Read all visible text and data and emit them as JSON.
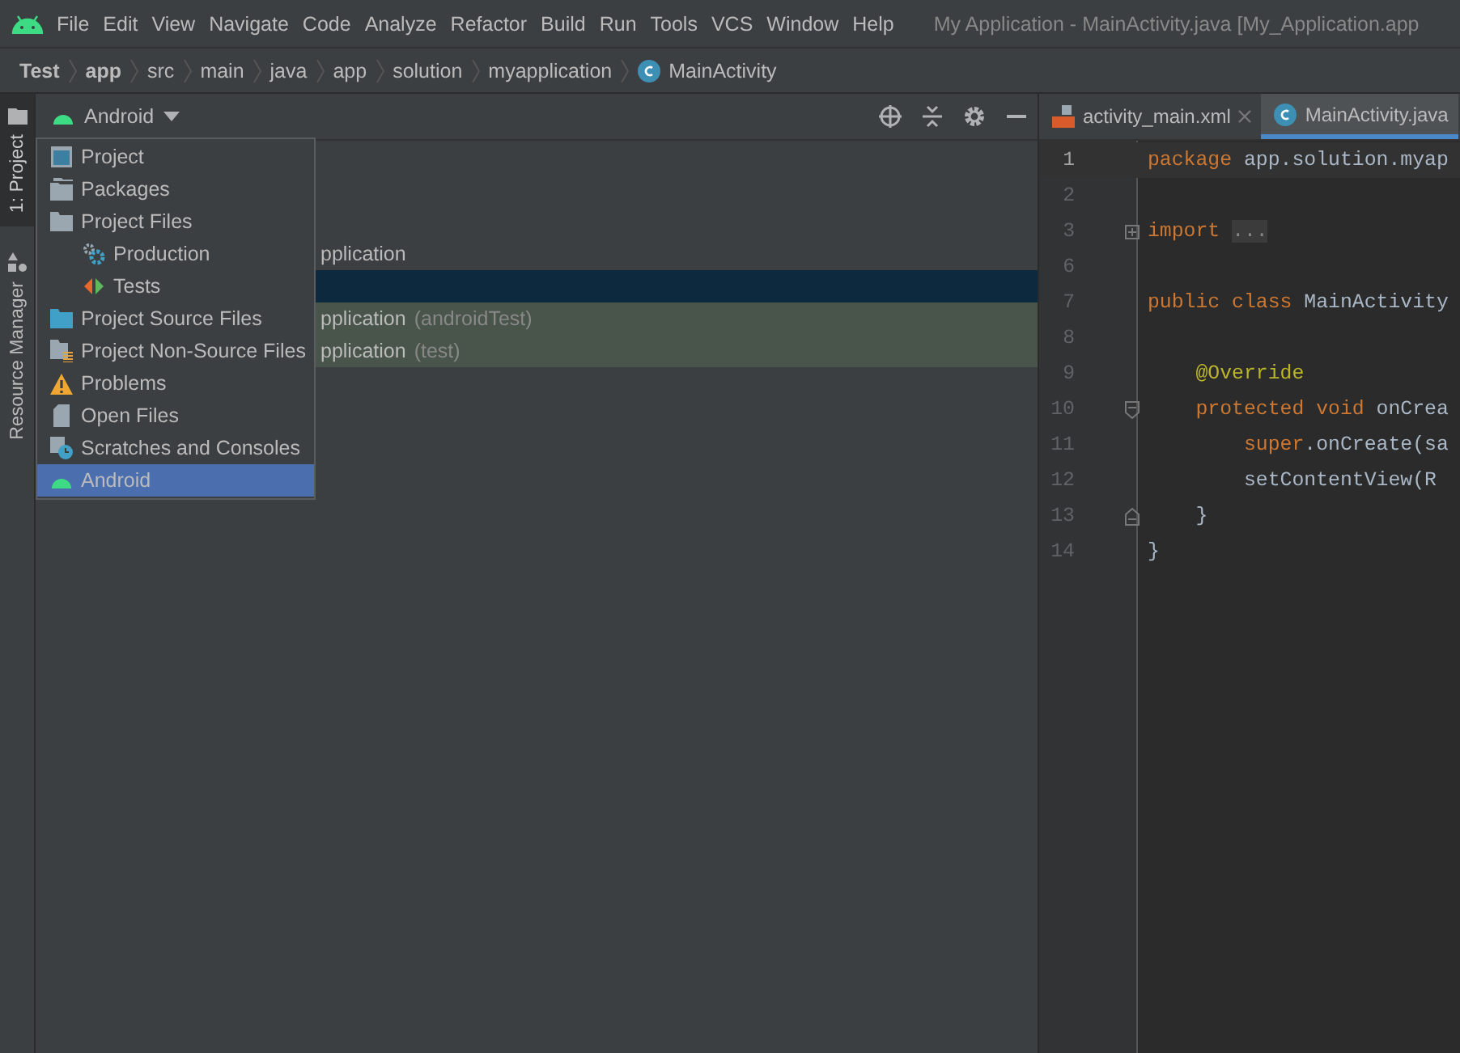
{
  "menu_bar": {
    "items": [
      "File",
      "Edit",
      "View",
      "Navigate",
      "Code",
      "Analyze",
      "Refactor",
      "Build",
      "Run",
      "Tools",
      "VCS",
      "Window",
      "Help"
    ],
    "title": "My Application - MainActivity.java [My_Application.app"
  },
  "breadcrumb": [
    {
      "label": "Test",
      "kind": "module"
    },
    {
      "label": "app",
      "kind": "module"
    },
    {
      "label": "src",
      "kind": "folder"
    },
    {
      "label": "main",
      "kind": "folder"
    },
    {
      "label": "java",
      "kind": "folder"
    },
    {
      "label": "app",
      "kind": "folder"
    },
    {
      "label": "solution",
      "kind": "folder"
    },
    {
      "label": "myapplication",
      "kind": "folder"
    },
    {
      "label": "MainActivity",
      "kind": "class"
    }
  ],
  "side_tabs": [
    {
      "label": "1: Project",
      "selected": true,
      "kind": "project"
    },
    {
      "label": "Resource Manager",
      "selected": false,
      "kind": "resources"
    }
  ],
  "project_panel": {
    "view_selector": "Android",
    "tree_rows": [
      {
        "text": "pplication",
        "selected": false,
        "kind": "plain"
      },
      {
        "selected": true,
        "kind": "plain"
      },
      {
        "text": "pplication",
        "note": "(androidTest)",
        "selected": false,
        "kind": "test"
      },
      {
        "text": "pplication",
        "note": "(test)",
        "selected": false,
        "kind": "test"
      }
    ],
    "view_menu": [
      {
        "label": "Project",
        "kind": "monitor",
        "selected": false
      },
      {
        "label": "Packages",
        "kind": "packages",
        "selected": false
      },
      {
        "label": "Project Files",
        "kind": "folder",
        "selected": false,
        "children": [
          {
            "label": "Production",
            "kind": "gears",
            "selected": false
          },
          {
            "label": "Tests",
            "kind": "arrows",
            "selected": false
          }
        ]
      },
      {
        "label": "Project Source Files",
        "kind": "source-folder",
        "selected": false
      },
      {
        "label": "Project Non-Source Files",
        "kind": "nonsource",
        "selected": false
      },
      {
        "label": "Problems",
        "kind": "warning",
        "selected": false
      },
      {
        "label": "Open Files",
        "kind": "file",
        "selected": false
      },
      {
        "label": "Scratches and Consoles",
        "kind": "scratch",
        "selected": false
      },
      {
        "label": "Android",
        "kind": "android",
        "selected": true
      }
    ]
  },
  "editor": {
    "tabs": [
      {
        "label": "activity_main.xml",
        "kind": "xml",
        "selected": false,
        "closable": true
      },
      {
        "label": "MainActivity.java",
        "kind": "class",
        "selected": true,
        "closable": false
      }
    ],
    "lines": [
      {
        "number": "1",
        "current": true,
        "kind": "plain",
        "tokens": [
          {
            "text": "package ",
            "kind": "keyword"
          },
          {
            "text": "app.solution.myap",
            "kind": "plain"
          }
        ]
      },
      {
        "number": "2",
        "current": false,
        "kind": "plain"
      },
      {
        "number": "3",
        "current": false,
        "kind": "fold-collapsed",
        "tokens": [
          {
            "text": "import ",
            "kind": "keyword"
          },
          {
            "text": "...",
            "kind": "folded"
          }
        ]
      },
      {
        "number": "6",
        "current": false,
        "kind": "plain"
      },
      {
        "number": "7",
        "current": false,
        "kind": "plain",
        "tokens": [
          {
            "text": "public class ",
            "kind": "keyword"
          },
          {
            "text": "MainActivity",
            "kind": "plain"
          }
        ]
      },
      {
        "number": "8",
        "current": false,
        "kind": "plain"
      },
      {
        "number": "9",
        "current": false,
        "kind": "plain",
        "tokens": [
          {
            "text": "    @Override",
            "kind": "annotation"
          }
        ]
      },
      {
        "number": "10",
        "current": false,
        "kind": "fold-start",
        "tokens": [
          {
            "text": "    protected void ",
            "kind": "keyword"
          },
          {
            "text": "onCrea",
            "kind": "plain"
          }
        ]
      },
      {
        "number": "11",
        "current": false,
        "kind": "plain",
        "tokens": [
          {
            "text": "        super",
            "kind": "keyword"
          },
          {
            "text": ".onCreate(sa",
            "kind": "plain"
          }
        ]
      },
      {
        "number": "12",
        "current": false,
        "kind": "plain",
        "tokens": [
          {
            "text": "        setContentView(R",
            "kind": "plain"
          }
        ]
      },
      {
        "number": "13",
        "current": false,
        "kind": "fold-end",
        "tokens": [
          {
            "text": "    }",
            "kind": "plain"
          }
        ]
      },
      {
        "number": "14",
        "current": false,
        "kind": "plain",
        "tokens": [
          {
            "text": "}",
            "kind": "plain"
          }
        ]
      }
    ]
  }
}
